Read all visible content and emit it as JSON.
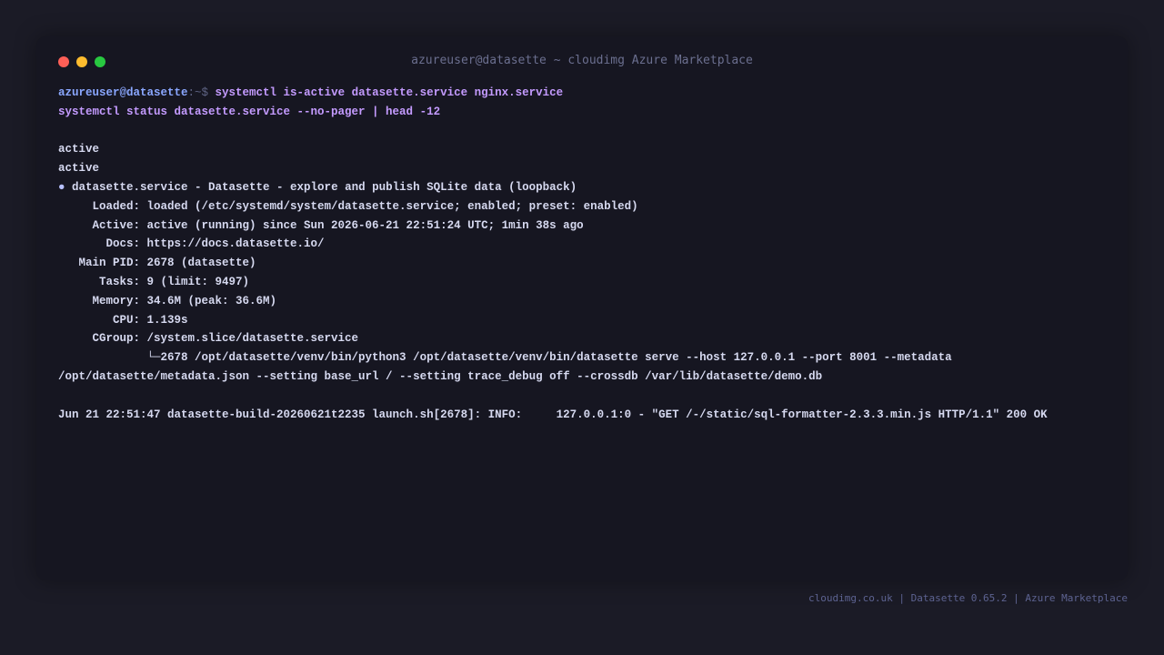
{
  "window": {
    "title": "azureuser@datasette ~ cloudimg Azure Marketplace"
  },
  "terminal": {
    "prompt_user": "azureuser@datasette",
    "prompt_sep": ":~$ ",
    "command_line_1": "systemctl is-active datasette.service nginx.service",
    "command_line_2": "systemctl status datasette.service --no-pager | head -12",
    "output": [
      "",
      "active",
      "active",
      "● datasette.service - Datasette - explore and publish SQLite data (loopback)",
      "     Loaded: loaded (/etc/systemd/system/datasette.service; enabled; preset: enabled)",
      "     Active: active (running) since Sun 2026-06-21 22:51:24 UTC; 1min 38s ago",
      "       Docs: https://docs.datasette.io/",
      "   Main PID: 2678 (datasette)",
      "      Tasks: 9 (limit: 9497)",
      "     Memory: 34.6M (peak: 36.6M)",
      "        CPU: 1.139s",
      "     CGroup: /system.slice/datasette.service",
      "             └─2678 /opt/datasette/venv/bin/python3 /opt/datasette/venv/bin/datasette serve --host 127.0.0.1 --port 8001 --metadata",
      "/opt/datasette/metadata.json --setting base_url / --setting trace_debug off --crossdb /var/lib/datasette/demo.db",
      "",
      "Jun 21 22:51:47 datasette-build-20260621t2235 launch.sh[2678]: INFO:     127.0.0.1:0 - \"GET /-/static/sql-formatter-2.3.3.min.js HTTP/1.1\" 200 OK"
    ]
  },
  "footer": {
    "text": "cloudimg.co.uk | Datasette 0.65.2 | Azure Marketplace"
  },
  "colors": {
    "close": "#fe5f57",
    "minimize": "#febc2e",
    "maximize": "#28c840"
  }
}
